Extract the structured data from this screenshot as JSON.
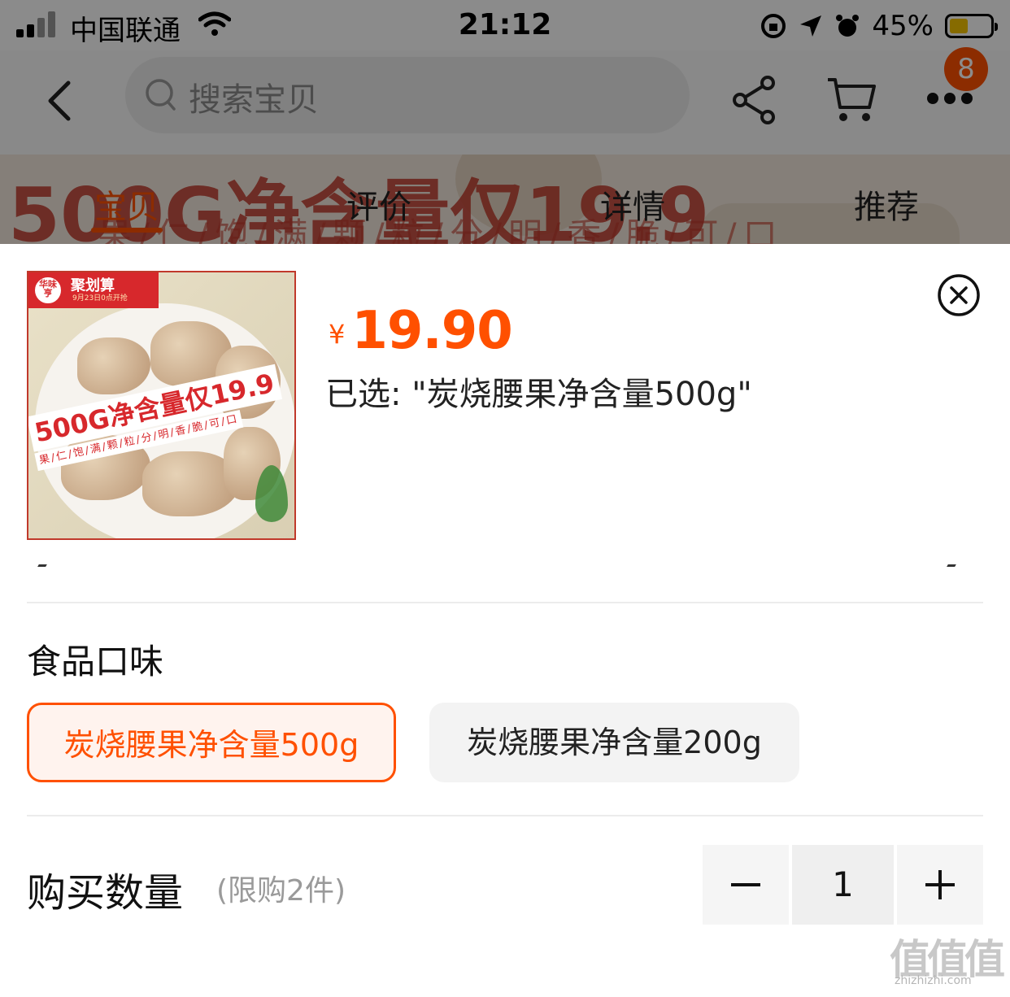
{
  "status_bar": {
    "carrier": "中国联通",
    "time": "21:12",
    "battery_percent": "45%",
    "battery_level": 0.45
  },
  "nav": {
    "search_placeholder": "搜索宝贝",
    "badge_count": "8",
    "icons": [
      "chevron-left-icon",
      "search-icon",
      "share-icon",
      "cart-icon",
      "more-icon"
    ]
  },
  "tabs": [
    {
      "label": "宝贝",
      "active": true
    },
    {
      "label": "评价",
      "active": false
    },
    {
      "label": "详情",
      "active": false
    },
    {
      "label": "推荐",
      "active": false
    }
  ],
  "banner": {
    "headline": "500G净含量仅19.9",
    "subline": "果/仁/饱/满/颗/粒/分/明/香/脆/可/口"
  },
  "product": {
    "thumbnail": {
      "logo_text": "华味亨",
      "promo_tag": "聚划算",
      "promo_sub": "9月23日0点开抢",
      "headline": "500G净含量仅19.9",
      "subline": "果/仁/饱/满/颗/粒/分/明/香/脆/可/口"
    },
    "currency": "¥",
    "price": "19.90",
    "selected_text": "已选: \"炭烧腰果净含量500g\""
  },
  "spec": {
    "title": "食品口味",
    "options": [
      {
        "label": "炭烧腰果净含量500g",
        "selected": true
      },
      {
        "label": "炭烧腰果净含量200g",
        "selected": false
      }
    ]
  },
  "quantity": {
    "title": "购买数量",
    "limit_text": "(限购2件)",
    "value": "1"
  },
  "colors": {
    "accent": "#ff5000",
    "promo_red": "#d7282c",
    "option_bg": "#f3f3f3"
  },
  "watermark": {
    "main": "值值值",
    "sub": "zhizhizhi.com"
  }
}
